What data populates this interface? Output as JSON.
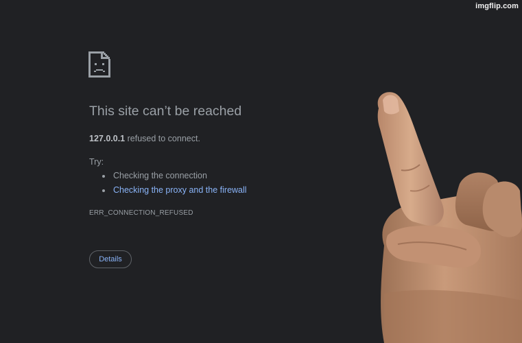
{
  "watermark": "imgflip.com",
  "icon": "sad-page-icon",
  "title": "This site can’t be reached",
  "summary": {
    "host": "127.0.0.1",
    "message": " refused to connect."
  },
  "try_label": "Try:",
  "suggestions": [
    {
      "label": "Checking the connection",
      "is_link": false
    },
    {
      "label": "Checking the proxy and the firewall",
      "is_link": true
    }
  ],
  "error_code": "ERR_CONNECTION_REFUSED",
  "details_button": "Details",
  "overlay_image": "middle-finger-hand",
  "colors": {
    "background": "#202124",
    "text": "#9aa0a6",
    "link": "#8ab4f8",
    "button_border": "#5f6368"
  }
}
